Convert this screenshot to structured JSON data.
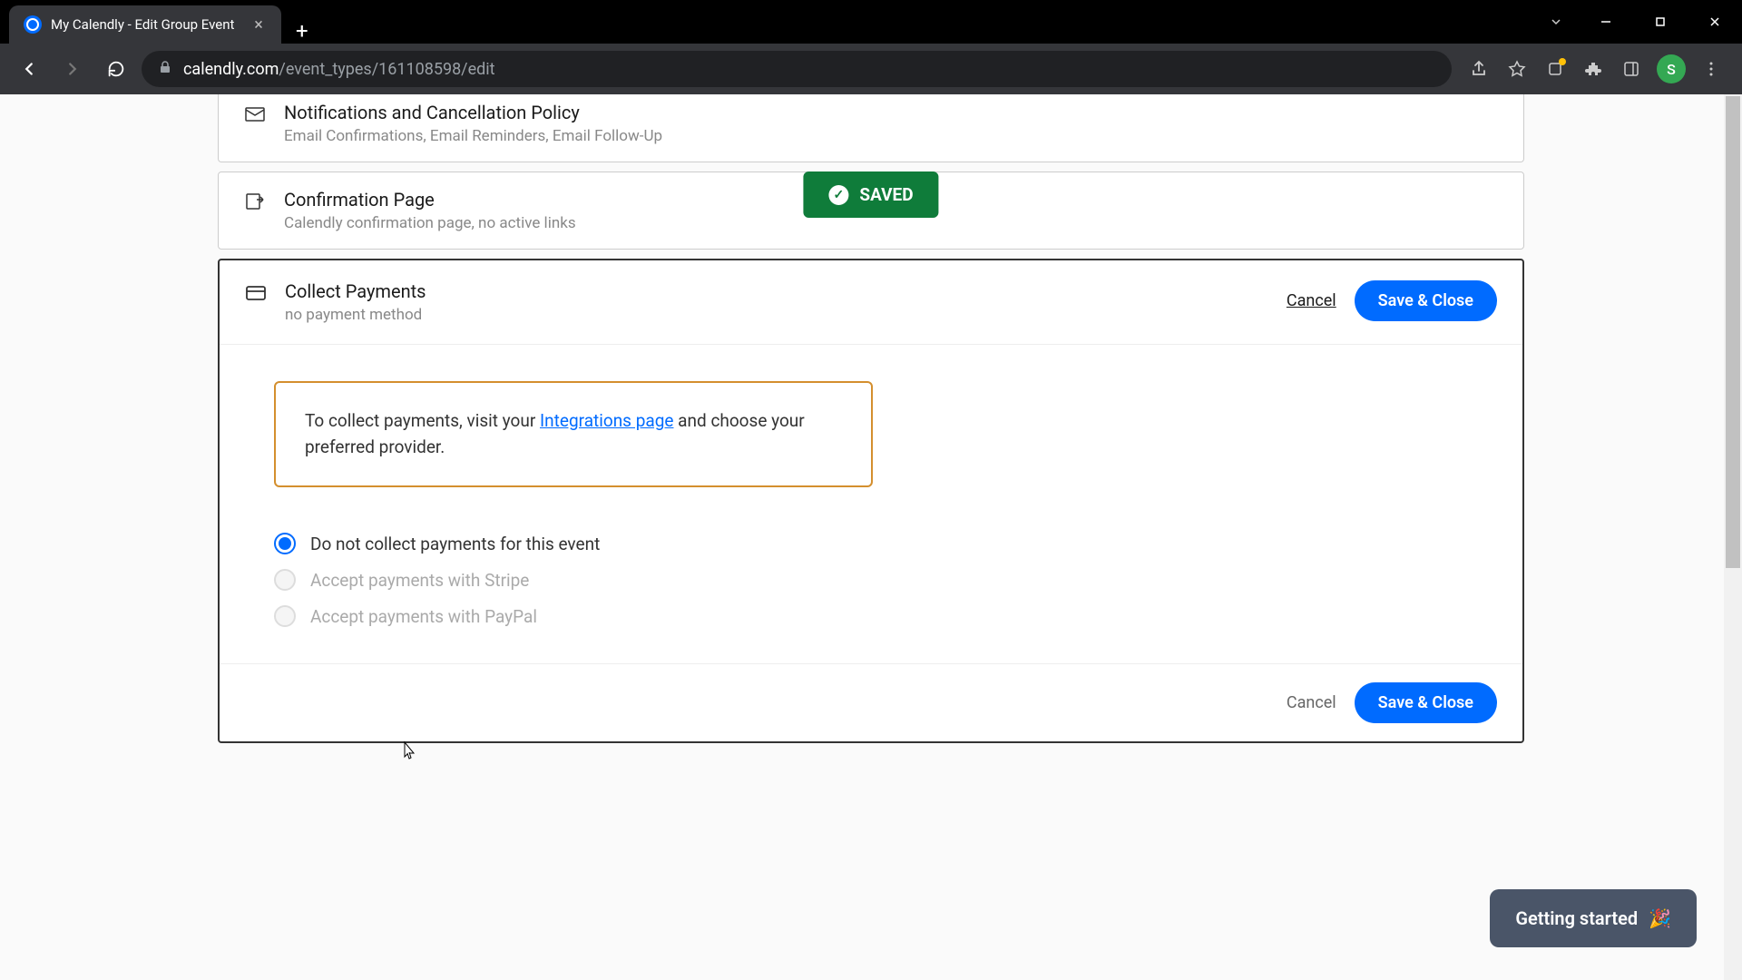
{
  "browser": {
    "tab_title": "My Calendly - Edit Group Event",
    "url_domain": "calendly.com",
    "url_path": "/event_types/161108598/edit",
    "avatar_letter": "S"
  },
  "toast": {
    "label": "SAVED"
  },
  "sections": {
    "notifications": {
      "title": "Notifications and Cancellation Policy",
      "subtitle": "Email Confirmations, Email Reminders, Email Follow-Up"
    },
    "confirmation": {
      "title": "Confirmation Page",
      "subtitle": "Calendly confirmation page, no active links"
    },
    "payments": {
      "title": "Collect Payments",
      "subtitle": "no payment method",
      "cancel_label": "Cancel",
      "save_label": "Save & Close"
    }
  },
  "notice": {
    "text_before": "To collect payments, visit your ",
    "link_text": "Integrations page",
    "text_after": " and choose your preferred provider."
  },
  "radio": {
    "option_none": "Do not collect payments for this event",
    "option_stripe": "Accept payments with Stripe",
    "option_paypal": "Accept payments with PayPal"
  },
  "footer": {
    "cancel_label": "Cancel",
    "save_label": "Save & Close"
  },
  "getting_started": {
    "label": "Getting started",
    "emoji": "🎉"
  }
}
